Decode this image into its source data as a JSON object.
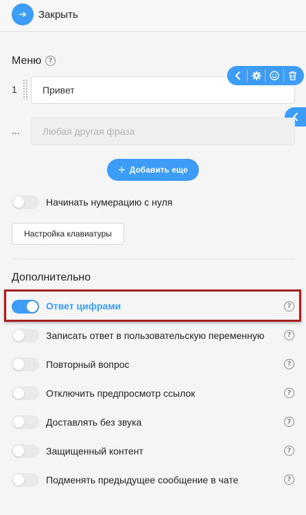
{
  "header": {
    "close_label": "Закрыть",
    "close_icon": "arrow-right-icon"
  },
  "menu": {
    "title": "Меню",
    "row_number": "1",
    "first_phrase": "Привет",
    "any_phrase_marker": "...",
    "any_phrase_placeholder": "Любая другая фраза",
    "add_more_label": "Добавить еще",
    "toolbar_icons": [
      "chevron-left-icon",
      "gear-icon",
      "smiley-icon",
      "trash-icon"
    ]
  },
  "numbering": {
    "label": "Начинать нумерацию с нуля",
    "enabled": false
  },
  "keyboard_settings_label": "Настройка клавиатуры",
  "additional": {
    "title": "Дополнительно",
    "options": [
      {
        "label": "Ответ цифрами",
        "enabled": true
      },
      {
        "label": "Записать ответ в пользовательскую переменную",
        "enabled": false
      },
      {
        "label": "Повторный вопрос",
        "enabled": false
      },
      {
        "label": "Отключить предпросмотр ссылок",
        "enabled": false
      },
      {
        "label": "Доставлять без звука",
        "enabled": false
      },
      {
        "label": "Защищенный контент",
        "enabled": false
      },
      {
        "label": "Подменять предыдущее сообщение в чате",
        "enabled": false
      }
    ]
  },
  "colors": {
    "accent": "#3d9cf5",
    "highlight": "#a32020"
  }
}
